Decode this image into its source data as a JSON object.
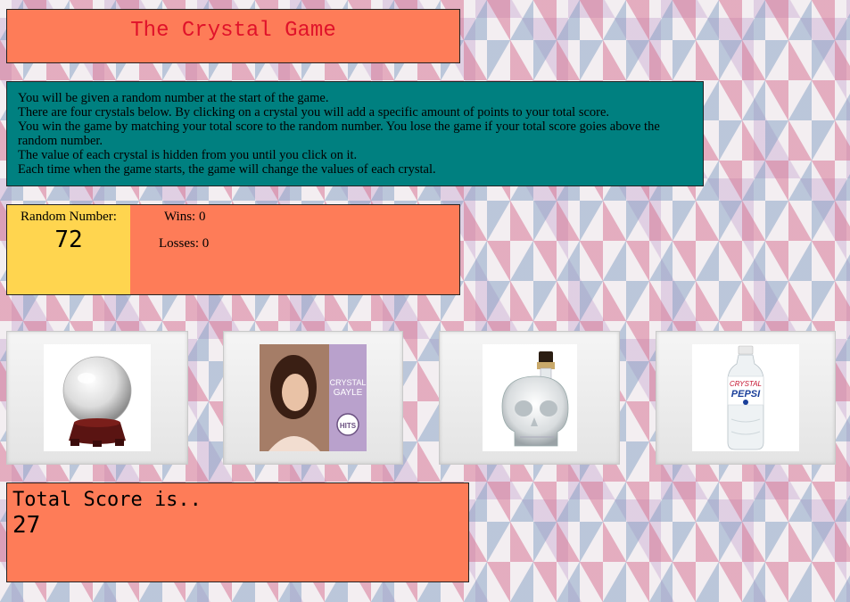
{
  "title": "The Crystal Game",
  "instructions": [
    "You will be given a random number at the start of the game.",
    "There are four crystals below. By clicking on a crystal you will add a specific amount of points to your total score.",
    "You win the game by matching your total score to the random number. You lose the game if your total score goies above the random number.",
    "The value of each crystal is hidden from you until you click on it.",
    "Each time when the game starts, the game will change the values of each crystal."
  ],
  "random": {
    "label": "Random Number:",
    "value": "72"
  },
  "wins": "Wins: 0",
  "losses": "Losses: 0",
  "crystals": [
    {
      "icon": "crystal-ball-icon"
    },
    {
      "icon": "crystal-gayle-album-icon",
      "text1": "CRYSTAL",
      "text2": "GAYLE",
      "badge": "HITS"
    },
    {
      "icon": "crystal-skull-bottle-icon"
    },
    {
      "icon": "crystal-pepsi-bottle-icon",
      "text1": "CRYSTAL",
      "text2": "PEPSI"
    }
  ],
  "score": {
    "label": "Total Score is..",
    "value": "27"
  },
  "colors": {
    "panel": "#fe7c58",
    "instructions": "#008080",
    "random": "#ffd54f",
    "title": "#e0122a"
  }
}
